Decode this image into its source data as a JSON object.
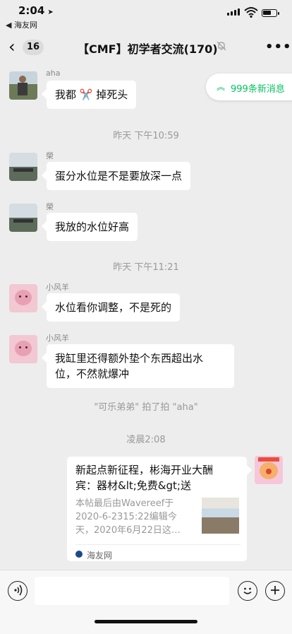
{
  "status_bar": {
    "time": "2:04",
    "back_app": "◀ 海友网"
  },
  "header": {
    "unread_count": "16",
    "title": "【CMF】初学者交流(170)"
  },
  "new_messages_label": "999条新消息",
  "messages": [
    {
      "sender": "aha",
      "text": "我都 ✂️ 掉死头"
    },
    {
      "timestamp": "昨天 下午10:59"
    },
    {
      "sender": "榮",
      "text": "蛋分水位是不是要放深一点"
    },
    {
      "sender": "榮",
      "text": "我放的水位好高"
    },
    {
      "timestamp": "昨天 下午11:21"
    },
    {
      "sender": "小风羊",
      "text": "水位看你调整，不是死的"
    },
    {
      "sender": "小风羊",
      "text_lines": [
        "我缸里还得额外垫个东西超出水",
        "位，不然就爆冲"
      ]
    },
    {
      "system": "\"可乐弟弟\" 拍了拍 \"aha\""
    },
    {
      "timestamp": "凌晨2:08"
    }
  ],
  "link_card": {
    "title_lines": [
      "新起点新征程，彬海开业大酬",
      "宾：器材&lt;免费&gt;送"
    ],
    "desc_lines": [
      "本帖最后由Wavereef于",
      "2020-6-2315:22编辑今",
      "天，2020年6月22日这…"
    ],
    "source": "海友网"
  },
  "icons": {
    "back": "chevron-left-icon",
    "mute": "bell-muted-icon",
    "more": "more-dots-icon",
    "voice": "voice-icon",
    "emoji": "emoji-icon",
    "plus": "plus-icon",
    "up": "double-chevron-up-icon"
  },
  "colors": {
    "accent": "#07c160",
    "background": "#ededed",
    "bubble": "#ffffff"
  }
}
